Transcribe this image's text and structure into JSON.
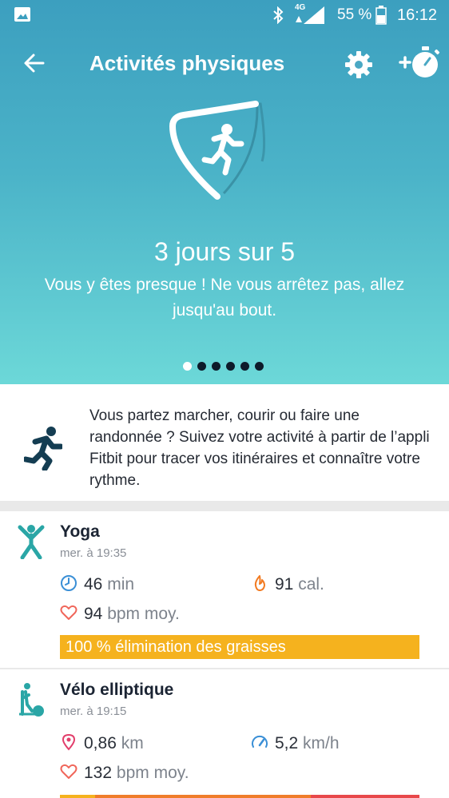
{
  "status_bar": {
    "battery_text": "55 %",
    "network": "4G",
    "time": "16:12"
  },
  "header": {
    "title": "Activités physiques",
    "back_icon": "arrow-left-icon",
    "settings_icon": "gear-icon",
    "add_icon": "add-stopwatch-icon"
  },
  "goal": {
    "title": "3 jours sur 5",
    "message": "Vous y êtes presque ! Ne vous arrêtez pas, allez jusqu'au bout.",
    "pages": 6,
    "active_page": 0
  },
  "promo": {
    "icon": "running-person-icon",
    "text": "Vous partez marcher, courir ou faire une randonnée ? Suivez votre activité à partir de l’appli Fitbit pour tracer vos itinéraires et connaître votre rythme."
  },
  "activities": [
    {
      "icon": "yoga-person-icon",
      "name": "Yoga",
      "time": "mer. à 19:35",
      "duration_value": "46",
      "duration_unit": "min",
      "calories_value": "91",
      "calories_unit": "cal.",
      "heart_value": "94",
      "heart_unit": "bpm moy.",
      "zone_label": "100 % élimination des graisses"
    },
    {
      "icon": "elliptical-icon",
      "name": "Vélo elliptique",
      "time": "mer. à 19:15",
      "distance_value": "0,86",
      "distance_unit": "km",
      "speed_value": "5,2",
      "speed_unit": "km/h",
      "heart_value": "132",
      "heart_unit": "bpm moy."
    }
  ],
  "colors": {
    "hero_top": "#3c9fbf",
    "hero_bottom": "#6cd8d8",
    "fat_burn": "#f5b21e",
    "cardio": "#f07d2a",
    "peak": "#e8484a",
    "teal_icon": "#2aa6a6"
  }
}
